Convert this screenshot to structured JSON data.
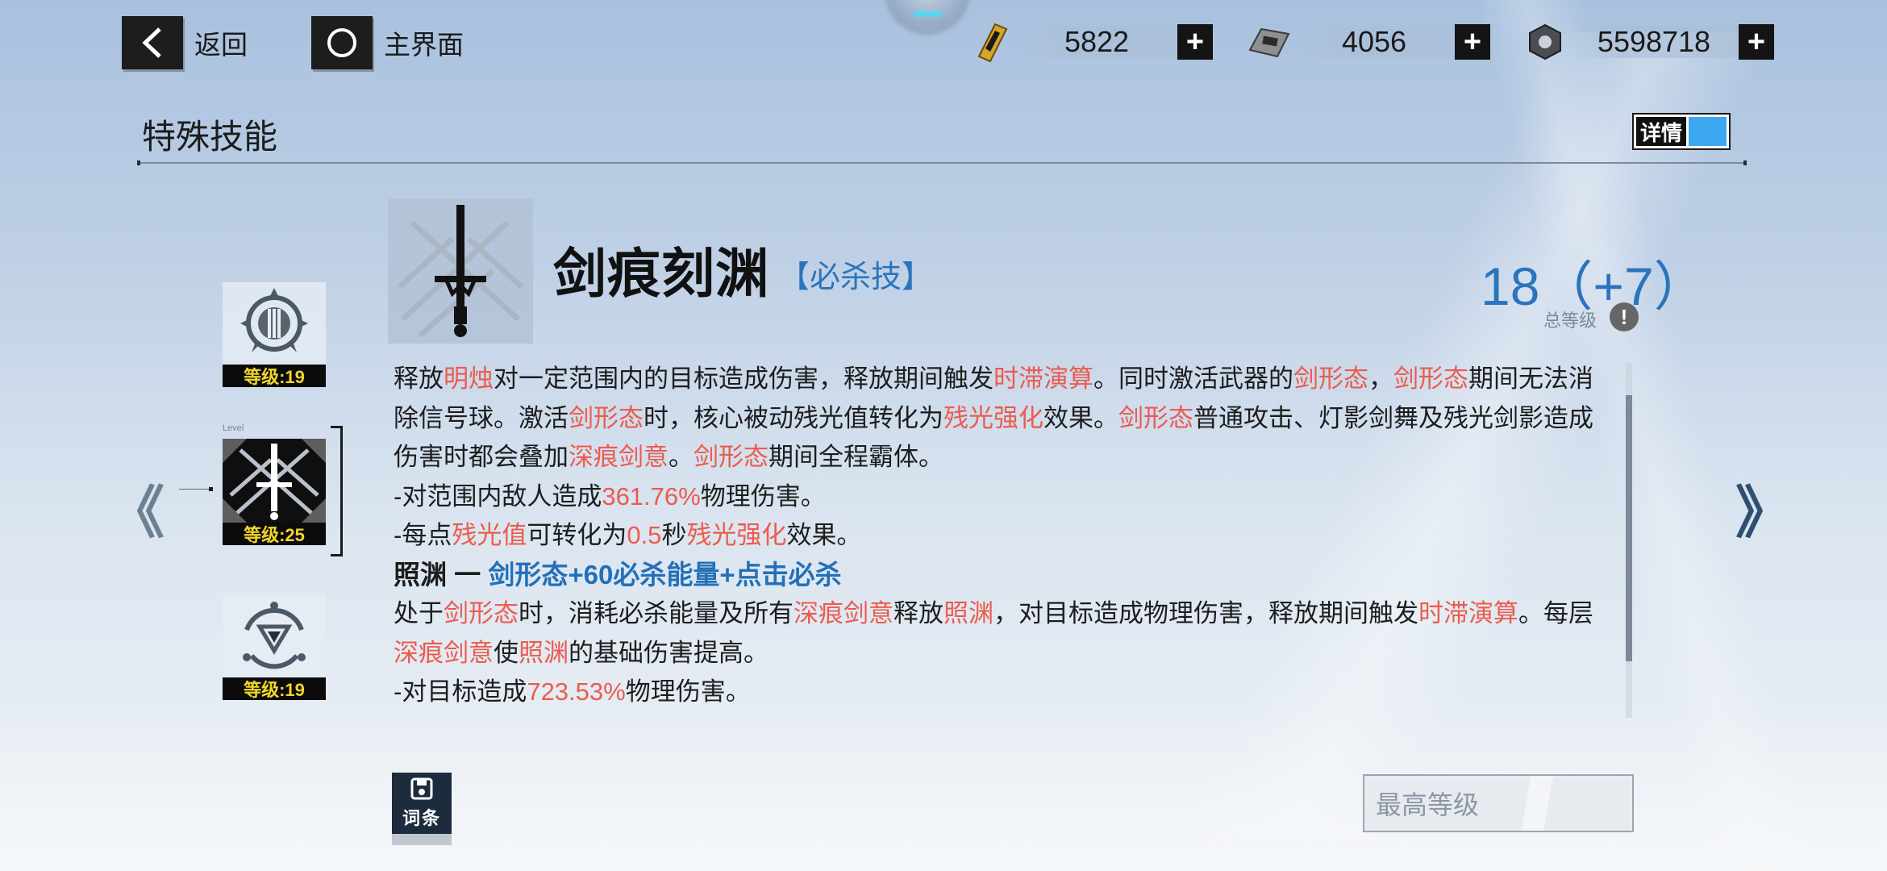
{
  "topbar": {
    "back_label": "返回",
    "home_label": "主界面",
    "resources": [
      {
        "icon": "gold-card-icon",
        "value": "5822"
      },
      {
        "icon": "silver-card-icon",
        "value": "4056"
      },
      {
        "icon": "gear-nut-icon",
        "value": "5598718"
      }
    ],
    "plus_label": "+"
  },
  "header": {
    "title": "特殊技能",
    "detail_toggle": "详情"
  },
  "skills": [
    {
      "level": "等级:19",
      "icon": "crest-skill-icon"
    },
    {
      "level": "等级:25",
      "icon": "sword-skill-icon",
      "selected": true,
      "tag": "Level"
    },
    {
      "level": "等级:19",
      "icon": "triangle-core-skill-icon"
    }
  ],
  "main": {
    "name": "剑痕刻渊",
    "type": "【必杀技】",
    "total_level": "18（+7）",
    "total_level_label": "总等级",
    "info_icon": "!"
  },
  "description": {
    "p1": [
      {
        "t": "释放"
      },
      {
        "t": "明烛",
        "h": 1
      },
      {
        "t": "对一定范围内的目标造成伤害，释放期间触发"
      },
      {
        "t": "时滞演算",
        "h": 1
      },
      {
        "t": "。同时激活武器的"
      },
      {
        "t": "剑形态",
        "h": 1
      },
      {
        "t": "，"
      },
      {
        "t": "剑形态",
        "h": 1
      },
      {
        "t": "期间无法消除信号球。激活"
      },
      {
        "t": "剑形态",
        "h": 1
      },
      {
        "t": "时，核心被动残光值转化为"
      },
      {
        "t": "残光强化",
        "h": 1
      },
      {
        "t": "效果。"
      },
      {
        "t": "剑形态",
        "h": 1
      },
      {
        "t": "普通攻击、灯影剑舞及残光剑影造成伤害时都会叠加"
      },
      {
        "t": "深痕剑意",
        "h": 1
      },
      {
        "t": "。"
      },
      {
        "t": "剑形态",
        "h": 1
      },
      {
        "t": "期间全程霸体。"
      }
    ],
    "p2": [
      {
        "t": "-对范围内敌人造成"
      },
      {
        "t": "361.76%",
        "h": 1
      },
      {
        "t": "物理伤害。"
      }
    ],
    "p3": [
      {
        "t": "-每点"
      },
      {
        "t": "残光值",
        "h": 1
      },
      {
        "t": "可转化为"
      },
      {
        "t": "0.5",
        "h": 1
      },
      {
        "t": "秒"
      },
      {
        "t": "残光强化",
        "h": 1
      },
      {
        "t": "效果。"
      }
    ],
    "sub_head_name": "照渊 一 ",
    "sub_head_cond": "剑形态+60必杀能量+点击必杀",
    "p4": [
      {
        "t": "处于"
      },
      {
        "t": "剑形态",
        "h": 1
      },
      {
        "t": "时，消耗必杀能量及所有"
      },
      {
        "t": "深痕剑意",
        "h": 1
      },
      {
        "t": "释放"
      },
      {
        "t": "照渊",
        "h": 1
      },
      {
        "t": "，对目标造成物理伤害，释放期间触发"
      },
      {
        "t": "时滞演算",
        "h": 1
      },
      {
        "t": "。每层"
      },
      {
        "t": "深痕剑意",
        "h": 1
      },
      {
        "t": "使"
      },
      {
        "t": "照渊",
        "h": 1
      },
      {
        "t": "的基础伤害提高。"
      }
    ],
    "p5": [
      {
        "t": "-对目标造成"
      },
      {
        "t": "723.53%",
        "h": 1
      },
      {
        "t": "物理伤害。"
      }
    ]
  },
  "bottom": {
    "entry_label": "词条",
    "max_level_label": "最高等级"
  },
  "nav": {
    "left": "《",
    "right": "》"
  },
  "colors": {
    "highlight": "#ec5b4e",
    "accent_blue": "#2a74bd",
    "level_yellow": "#f1d52c"
  }
}
